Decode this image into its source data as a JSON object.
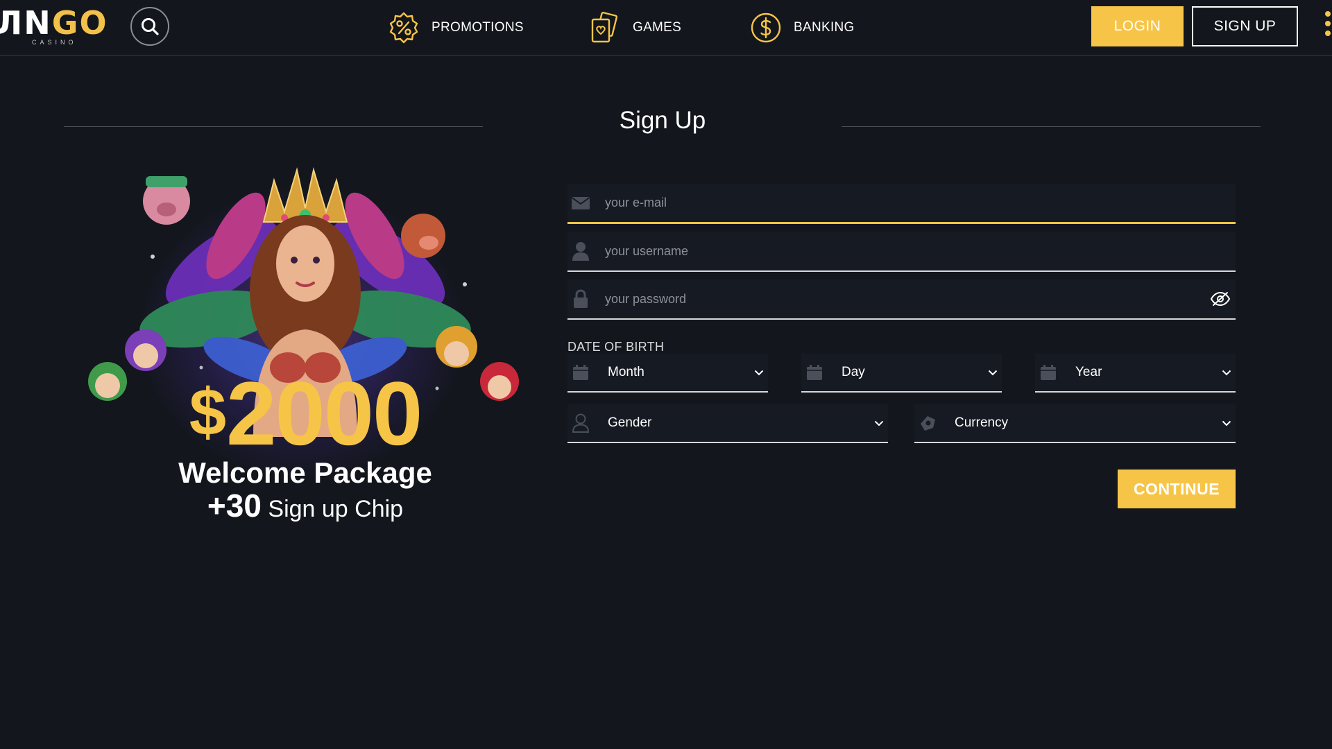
{
  "brand": {
    "logo_text_white": "ЛN",
    "logo_text_gold": "GO",
    "logo_sub": "CASINO"
  },
  "nav": {
    "search_icon": "search-icon",
    "items": [
      {
        "label": "PROMOTIONS",
        "icon": "percent-badge-icon"
      },
      {
        "label": "GAMES",
        "icon": "cards-icon"
      },
      {
        "label": "BANKING",
        "icon": "dollar-coin-icon"
      }
    ],
    "login_label": "LOGIN",
    "signup_label": "SIGN UP"
  },
  "page": {
    "title": "Sign Up"
  },
  "promo": {
    "currency": "$",
    "amount": "2000",
    "line1": "Welcome Package",
    "chip_amount": "+30",
    "chip_text": "Sign up Chip"
  },
  "form": {
    "email_placeholder": "your e-mail",
    "username_placeholder": "your username",
    "password_placeholder": "your password",
    "dob_label": "DATE OF BIRTH",
    "month_value": "Month",
    "day_value": "Day",
    "year_value": "Year",
    "gender_value": "Gender",
    "currency_value": "Currency",
    "continue_label": "CONTINUE"
  },
  "colors": {
    "accent": "#f6c548",
    "background": "#13161c",
    "field_bg": "#161a22"
  }
}
